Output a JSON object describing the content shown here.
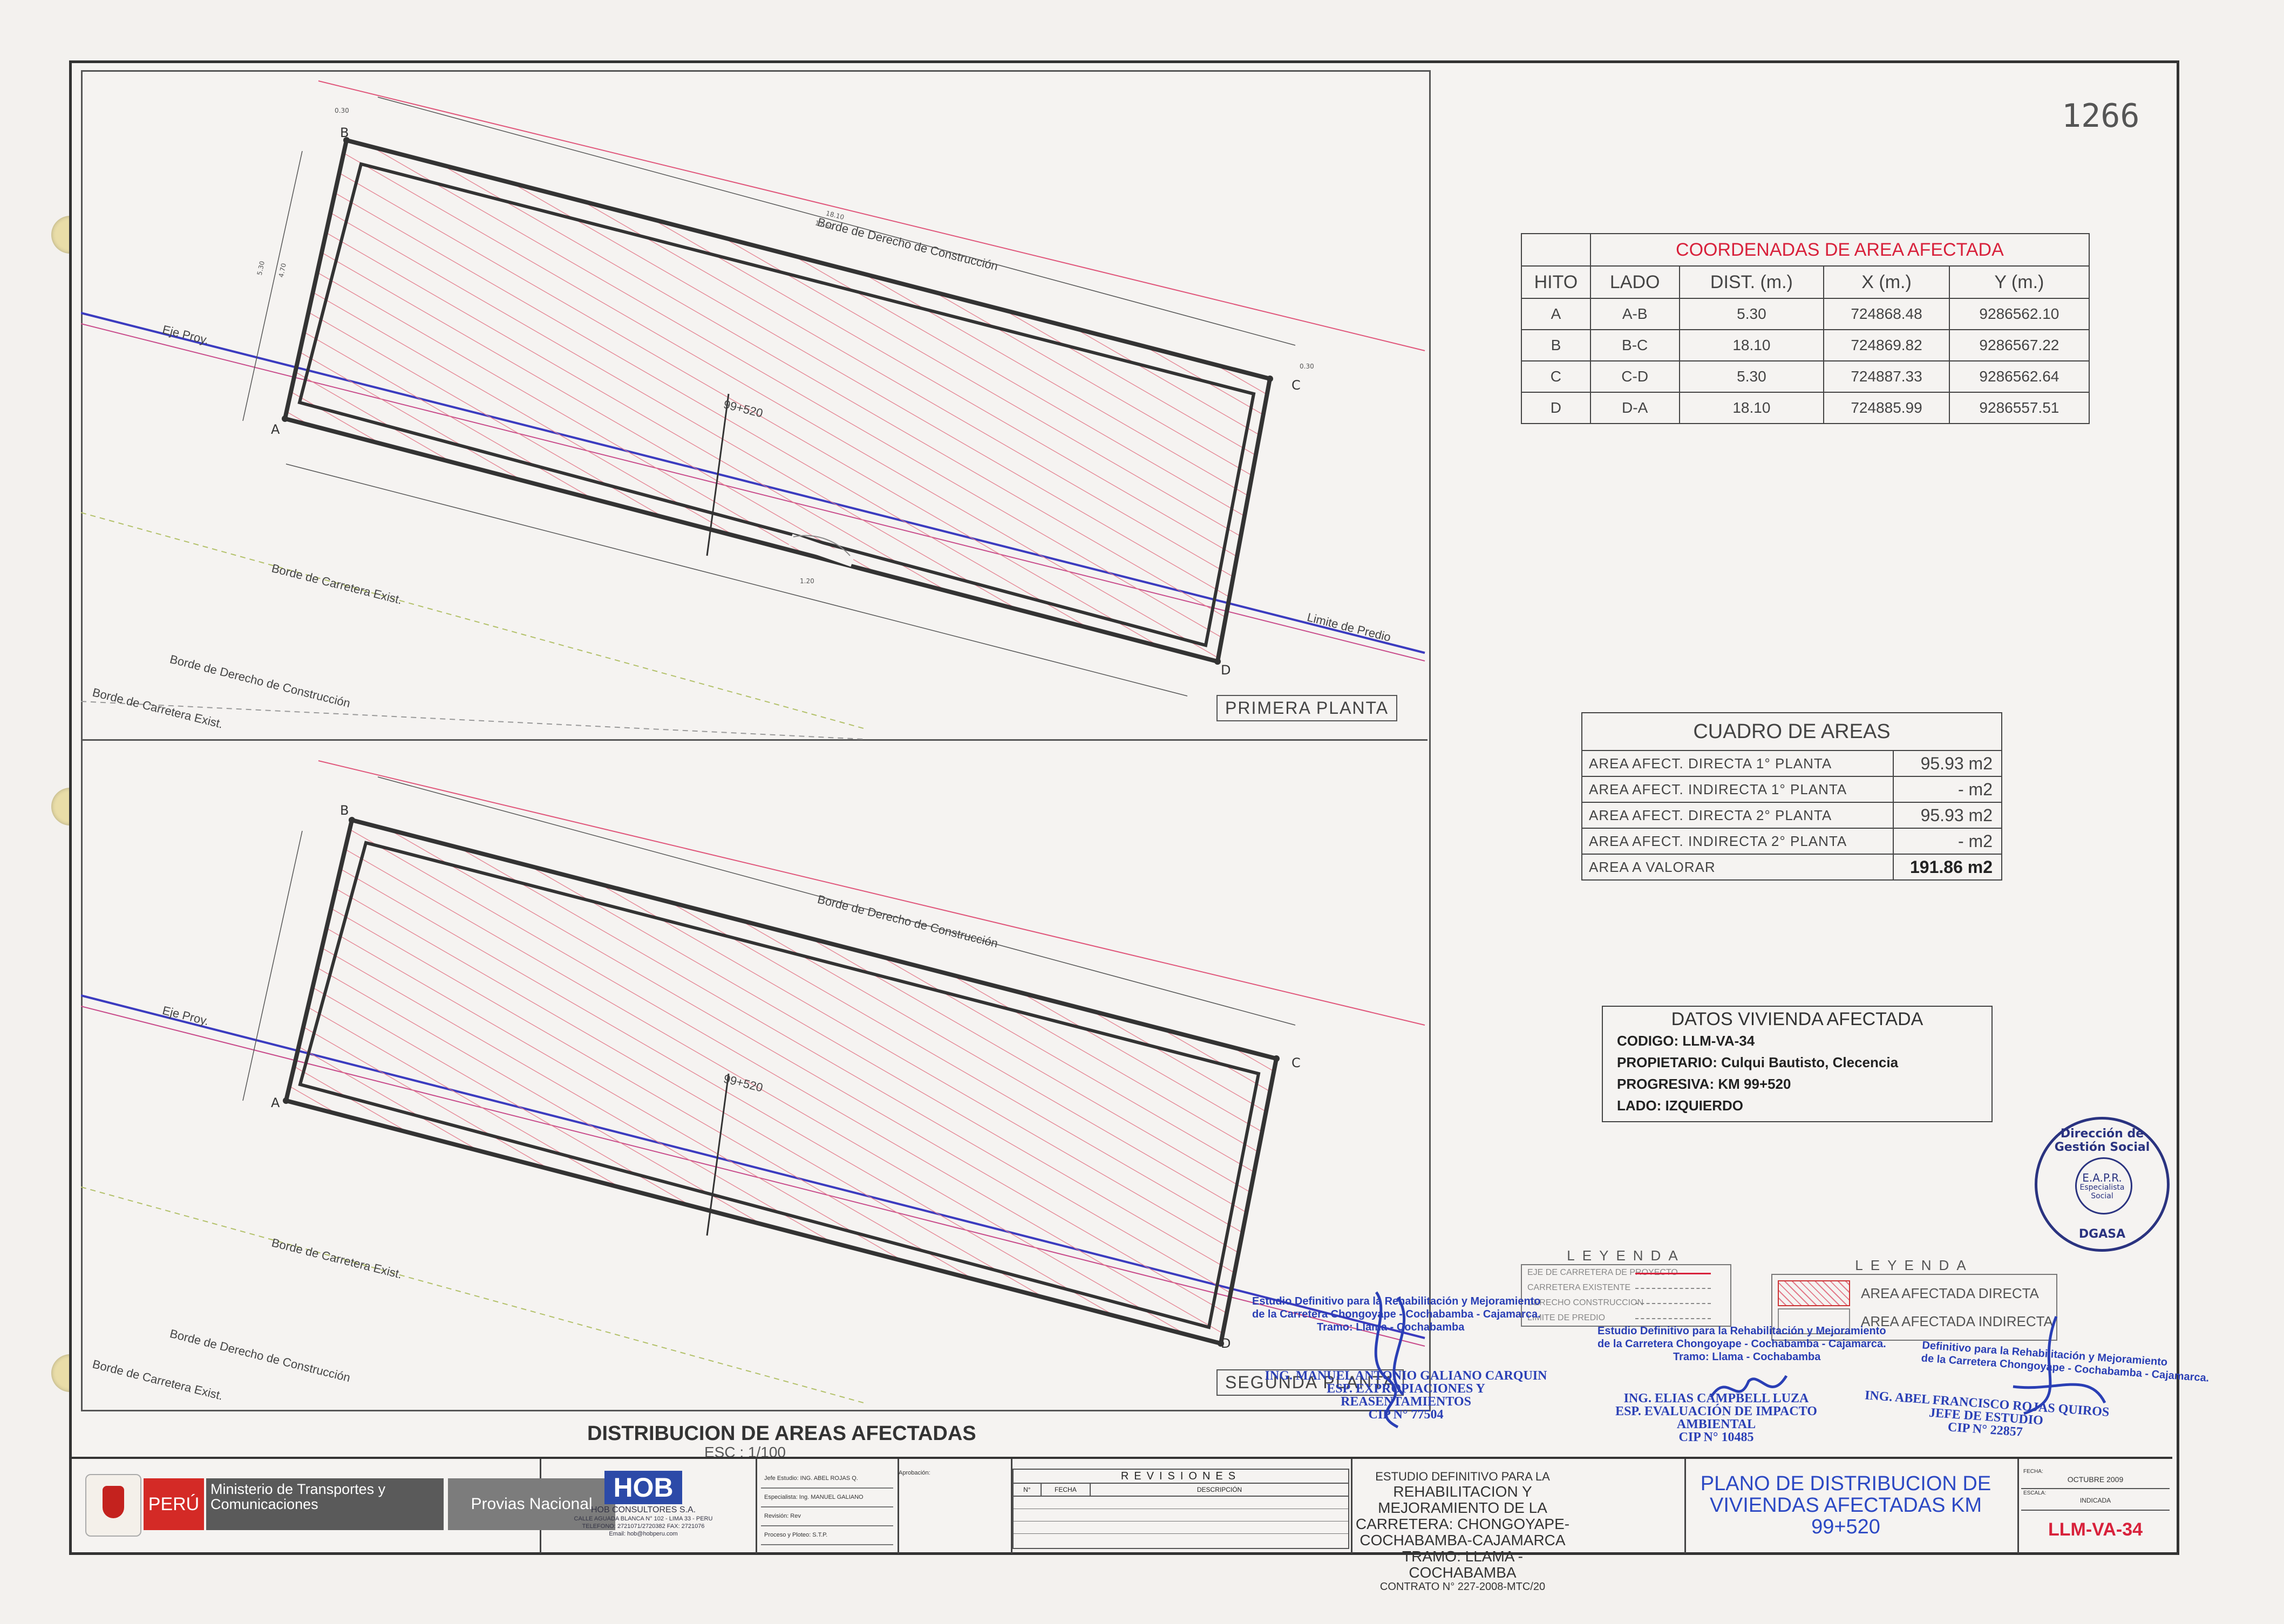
{
  "page_number": "1266",
  "plans": [
    {
      "label": "PRIMERA PLANTA"
    },
    {
      "label": "SEGUNDA PLANTA"
    }
  ],
  "drawing_labels": {
    "eje": "Eje Proy.",
    "borde_derecho": "Borde de Derecho de Construcción",
    "borde_carretera": "Borde de Carretera Exist.",
    "limite_predio": "Limite de Predio",
    "progresiva": "99+520",
    "points": [
      "A",
      "B",
      "C",
      "D"
    ],
    "dims": [
      "5.30",
      "18.10",
      "0.30",
      "1.20",
      "17.50",
      "4.70"
    ]
  },
  "coords_table": {
    "title": "COORDENADAS DE AREA AFECTADA",
    "headers": [
      "HITO",
      "LADO",
      "DIST. (m.)",
      "X (m.)",
      "Y (m.)"
    ],
    "rows": [
      [
        "A",
        "A-B",
        "5.30",
        "724868.48",
        "9286562.10"
      ],
      [
        "B",
        "B-C",
        "18.10",
        "724869.82",
        "9286567.22"
      ],
      [
        "C",
        "C-D",
        "5.30",
        "724887.33",
        "9286562.64"
      ],
      [
        "D",
        "D-A",
        "18.10",
        "724885.99",
        "9286557.51"
      ]
    ]
  },
  "areas_table": {
    "title": "CUADRO DE AREAS",
    "rows": [
      {
        "label": "AREA AFECT. DIRECTA 1° PLANTA",
        "value": "95.93 m2"
      },
      {
        "label": "AREA AFECT. INDIRECTA 1° PLANTA",
        "value": "- m2"
      },
      {
        "label": "AREA AFECT. DIRECTA 2° PLANTA",
        "value": "95.93 m2"
      },
      {
        "label": "AREA AFECT. INDIRECTA 2° PLANTA",
        "value": "- m2"
      },
      {
        "label": "AREA A VALORAR",
        "value": "191.86 m2"
      }
    ]
  },
  "datos": {
    "title": "DATOS VIVIENDA AFECTADA",
    "codigo": "CODIGO: LLM-VA-34",
    "propietario": "PROPIETARIO: Culqui Bautisto, Clecencia",
    "progresiva": "PROGRESIVA: KM 99+520",
    "lado": "LADO: IZQUIERDO"
  },
  "stamp": {
    "top": "Dirección de Gestión Social",
    "mid1": "E.A.P.R.",
    "mid2": "Especialista",
    "mid3": "Social",
    "bottom": "DGASA"
  },
  "leyenda1": {
    "title": "LEYENDA",
    "rows": [
      "EJE DE CARRETERA DE PROYECTO",
      "CARRETERA EXISTENTE",
      "DERECHO CONSTRUCCION",
      "LIMITE DE PREDIO"
    ]
  },
  "leyenda2": {
    "title": "LEYENDA",
    "rows": [
      "AREA AFECTADA DIRECTA",
      "AREA AFECTADA INDIRECTA"
    ]
  },
  "signatures": {
    "s1_line1": "Estudio Definitivo para la Rehabilitación y Mejoramiento",
    "s1_line2": "de la Carretera Chongoyape - Cochabamba - Cajamarca.",
    "s1_line3": "Tramo: Llama - Cochabamba",
    "s1_name": "ING. MANUEL ANTONIO GALIANO CARQUIN",
    "s1_role": "ESP. EXPROPIACIONES Y REASENTAMIENTOS",
    "s1_cip": "CIP N° 77504",
    "s2_line1": "Estudio Definitivo para la Rehabilitación y Mejoramiento",
    "s2_line2": "de la Carretera Chongoyape - Cochabamba - Cajamarca.",
    "s2_line3": "Tramo: Llama - Cochabamba",
    "s2_name": "ING. ELIAS CAMPBELL LUZA",
    "s2_role": "ESP. EVALUACIÓN DE IMPACTO AMBIENTAL",
    "s2_cip": "CIP N° 10485",
    "s3_line1": "Definitivo para la Rehabilitación y Mejoramiento",
    "s3_line2": "de la Carretera Chongoyape - Cochabamba - Cajamarca.",
    "s3_name": "ING. ABEL FRANCISCO ROJAS QUIROS",
    "s3_role": "JEFE DE ESTUDIO",
    "s3_cip": "CIP N° 22857"
  },
  "sheet_title": "DISTRIBUCION DE AREAS AFECTADAS",
  "sheet_scale": "ESC : 1/100",
  "title_block": {
    "peru": "PERÚ",
    "ministerio": "Ministerio de Transportes y Comunicaciones",
    "provias": "Provias Nacional",
    "hob_mark": "HOB",
    "hob_name": "HOB CONSULTORES S.A.",
    "hob_addr1": "CALLE AGUADA BLANCA N° 102 - LIMA 33 - PERU",
    "hob_addr2": "TELEFONO: 2721071/2720382 FAX: 2721076",
    "hob_addr3": "Email: hob@hobperu.com",
    "staff": [
      "Jefe Estudio:  ING. ABEL ROJAS Q.",
      "Especialista:  Ing. MANUEL GALIANO",
      "Revisión:  Rev",
      "Proceso y Ploteo:  S.T.P."
    ],
    "aprobacion": "Aprobación:",
    "revisiones": "REVISIONES",
    "rev_headers": [
      "N°",
      "FECHA",
      "DESCRIPCIÓN"
    ],
    "estudio_a": "ESTUDIO DEFINITIVO PARA LA",
    "estudio_b": "REHABILITACION Y MEJORAMIENTO DE LA CARRETERA: CHONGOYAPE-COCHABAMBA-CAJAMARCA",
    "estudio_c": "TRAMO: LLAMA - COCHABAMBA",
    "estudio_d": "CONTRATO N° 227-2008-MTC/20",
    "plano": "PLANO DE DISTRIBUCION DE VIVIENDAS AFECTADAS KM 99+520",
    "fecha_k": "FECHA:",
    "fecha_v": "OCTUBRE 2009",
    "escala_k": "ESCALA:",
    "escala_v": "INDICADA",
    "code": "LLM-VA-34"
  },
  "colors": {
    "red": "#d8213b",
    "blue": "#2a3fb5",
    "hatch": "#e37a8a"
  }
}
